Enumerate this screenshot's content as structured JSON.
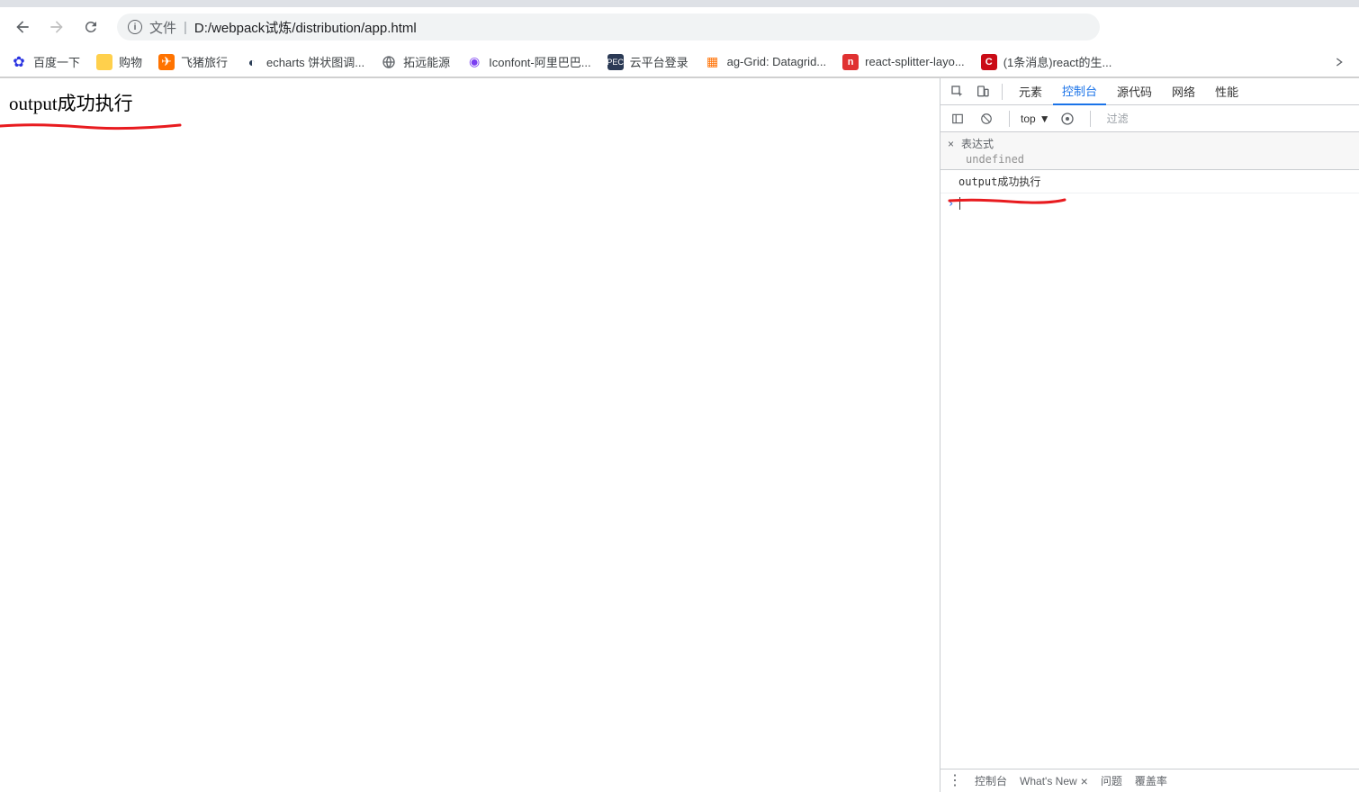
{
  "address_bar": {
    "prefix": "文件",
    "path": "D:/webpack试炼/distribution/app.html"
  },
  "bookmarks": [
    {
      "label": "百度一下",
      "icon": "baidu"
    },
    {
      "label": "购物",
      "icon": "folder"
    },
    {
      "label": "飞猪旅行",
      "icon": "fliggy"
    },
    {
      "label": "echarts 饼状图调...",
      "icon": "echarts"
    },
    {
      "label": "拓远能源",
      "icon": "globe"
    },
    {
      "label": "Iconfont-阿里巴巴...",
      "icon": "iconfont"
    },
    {
      "label": "云平台登录",
      "icon": "dark"
    },
    {
      "label": "ag-Grid: Datagrid...",
      "icon": "aggrid"
    },
    {
      "label": "react-splitter-layo...",
      "icon": "npm"
    },
    {
      "label": "(1条消息)react的生...",
      "icon": "csdn"
    }
  ],
  "page": {
    "body_text": "output成功执行"
  },
  "devtools": {
    "tabs": {
      "elements": "元素",
      "console": "控制台",
      "sources": "源代码",
      "network": "网络",
      "performance": "性能"
    },
    "toolbar": {
      "context": "top",
      "filter_placeholder": "过滤"
    },
    "watch": {
      "label": "表达式",
      "value": "undefined"
    },
    "console_log": "output成功执行",
    "drawer": {
      "console": "控制台",
      "whatsnew": "What's New",
      "issues": "问题",
      "coverage": "覆盖率"
    }
  }
}
